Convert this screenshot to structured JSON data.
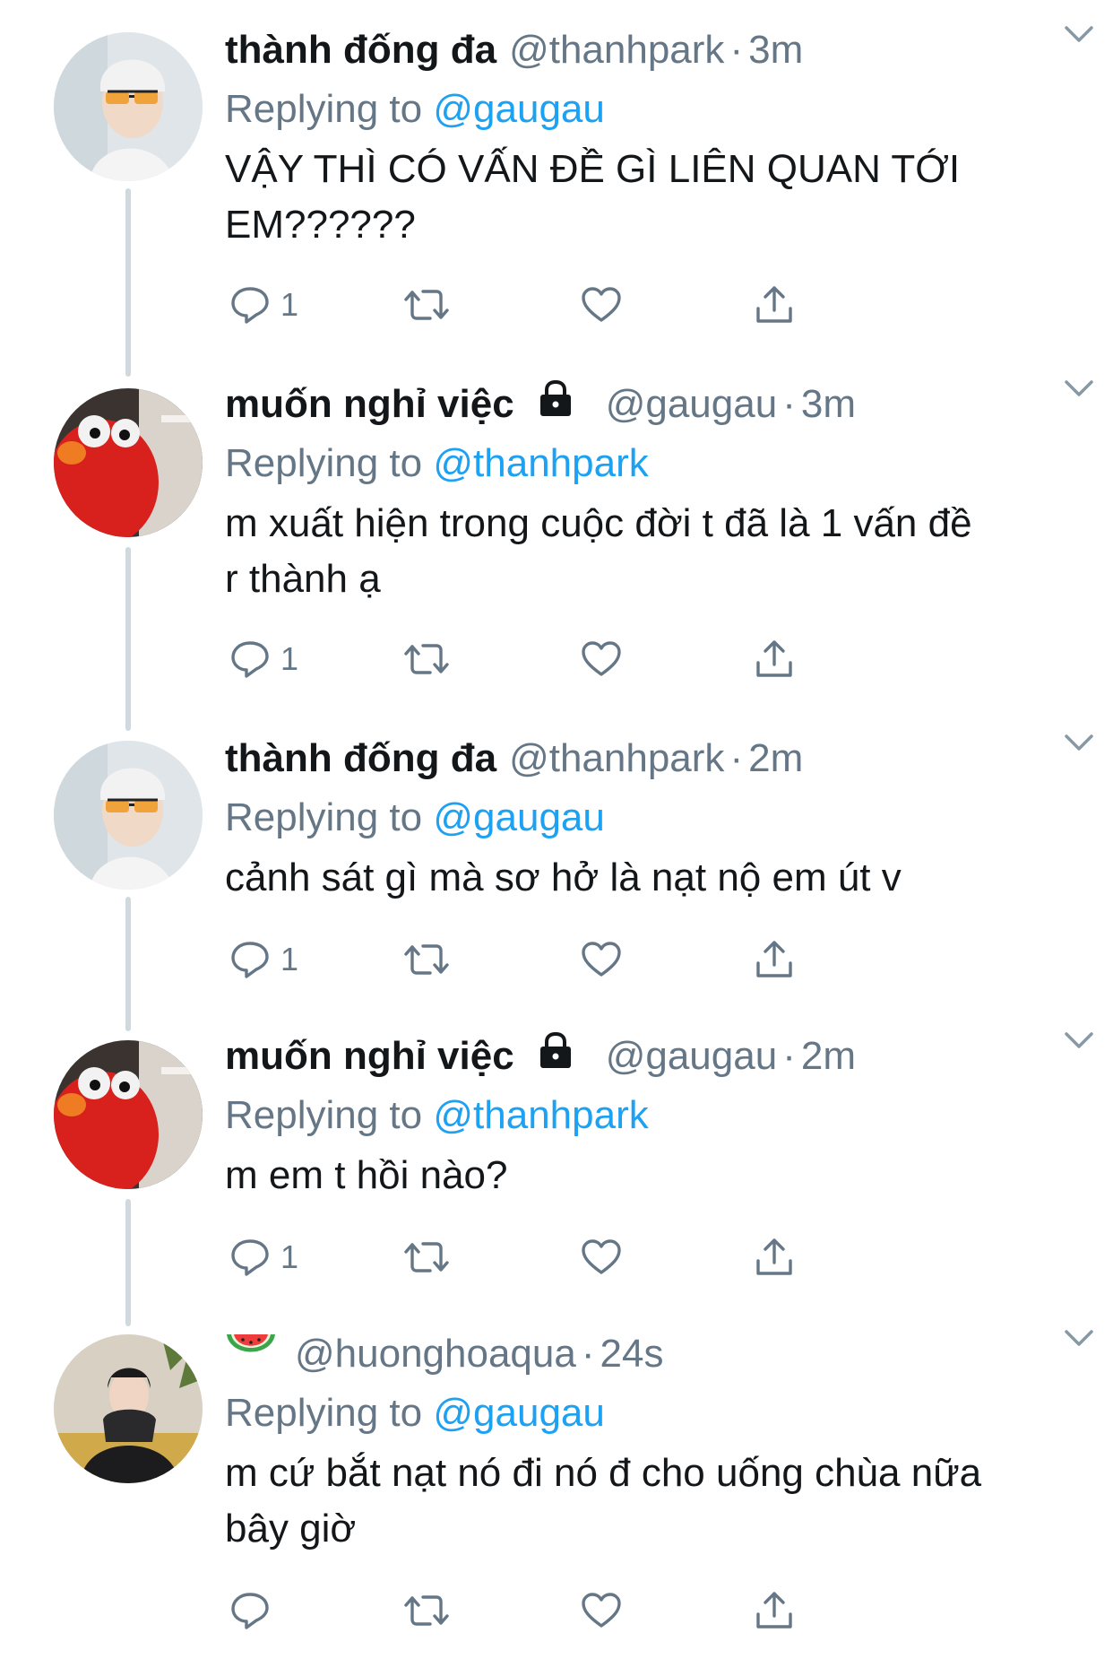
{
  "tweets": [
    {
      "display_name": "thành đống đa",
      "handle": "@thanhpark",
      "separator": "·",
      "time": "3m",
      "replying_prefix": "Replying to",
      "replying_to": "@gaugau",
      "text": "VẬY THÌ CÓ VẤN ĐỀ GÌ LIÊN QUAN TỚI\nEM??????",
      "reply_count": "1",
      "locked": false,
      "avatar_icon": "avatar-boy-glasses"
    },
    {
      "display_name": "muốn nghỉ việc",
      "handle": "@gaugau",
      "separator": "·",
      "time": "3m",
      "replying_prefix": "Replying to",
      "replying_to": "@thanhpark",
      "text": "m xuất hiện trong cuộc đời t đã là 1 vấn đề\nr thành ạ",
      "reply_count": "1",
      "locked": true,
      "avatar_icon": "avatar-red-puppet"
    },
    {
      "display_name": "thành đống đa",
      "handle": "@thanhpark",
      "separator": "·",
      "time": "2m",
      "replying_prefix": "Replying to",
      "replying_to": "@gaugau",
      "text": "cảnh sát gì mà sơ hở là nạt nộ em út v",
      "reply_count": "1",
      "locked": false,
      "avatar_icon": "avatar-boy-glasses"
    },
    {
      "display_name": "muốn nghỉ việc",
      "handle": "@gaugau",
      "separator": "·",
      "time": "2m",
      "replying_prefix": "Replying to",
      "replying_to": "@thanhpark",
      "text": "m em t hồi nào?",
      "reply_count": "1",
      "locked": true,
      "avatar_icon": "avatar-red-puppet"
    },
    {
      "display_name": "",
      "name_emoji": "watermelon-icon",
      "handle": "@huonghoaqua",
      "separator": "·",
      "time": "24s",
      "replying_prefix": "Replying to",
      "replying_to": "@gaugau",
      "text": "m cứ bắt nạt nó đi nó đ cho uống chùa nữa\nbây giờ",
      "reply_count": "",
      "locked": false,
      "avatar_icon": "avatar-person-dark-jacket"
    }
  ],
  "colors": {
    "text": "#14171a",
    "muted": "#657786",
    "link": "#1da1f2",
    "thread_line": "#cfd9de",
    "background": "#ffffff"
  },
  "action_icons": [
    "reply-icon",
    "retweet-icon",
    "like-icon",
    "share-icon"
  ]
}
